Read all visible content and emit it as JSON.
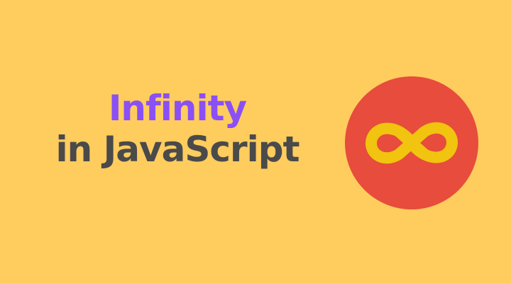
{
  "title": {
    "line1": "Infinity",
    "line2": "in JavaScript"
  },
  "logo": {
    "icon": "infinity-icon",
    "circle_color": "#e74c3c",
    "symbol_color": "#f1c40f"
  },
  "colors": {
    "background": "#ffcc5e",
    "title_line1": "#8a50f4",
    "title_line2": "#4a4a4a"
  }
}
